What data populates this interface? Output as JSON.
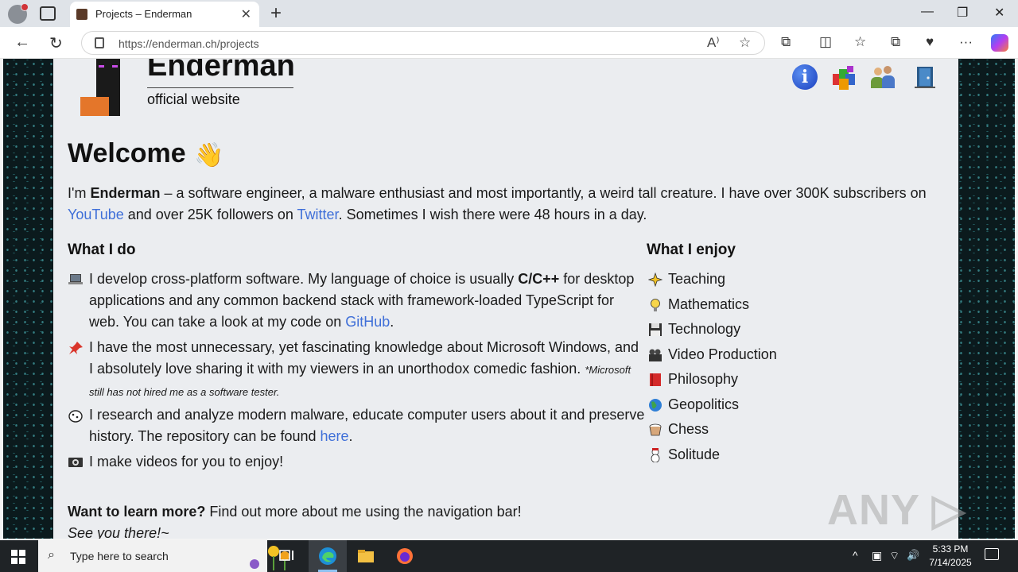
{
  "browser": {
    "tab_title": "Projects – Enderman",
    "new_tab": "+",
    "url": "https://enderman.ch/projects",
    "icons": {
      "back": "←",
      "refresh": "↻",
      "read_aloud": "A⁾",
      "favorite": "☆",
      "extensions": "⧉",
      "split": "◫",
      "favorites": "☆",
      "collections": "⧉",
      "performance": "♥",
      "more": "···",
      "minimize": "—",
      "restore": "❐",
      "close": "✕",
      "tab_close": "✕"
    }
  },
  "site": {
    "name": "Enderman",
    "subtitle": "official website",
    "info_icon_label": "i"
  },
  "welcome": {
    "title": "Welcome",
    "wave": "👋",
    "intro_1": "I'm ",
    "intro_name": "Enderman",
    "intro_2": " – a software engineer, a malware enthusiast and most importantly, a weird tall creature. I have over 300K subscribers on",
    "youtube": "YouTube",
    "intro_3": " and over 25K followers on ",
    "twitter": "Twitter",
    "intro_4": ". Sometimes I wish there were 48 hours in a day."
  },
  "what_i_do": {
    "heading": "What I do",
    "item1_a": "I develop cross-platform software. My language of choice is usually ",
    "item1_bold": "C/C++",
    "item1_b": " for desktop",
    "item1_line2": "applications and any common backend stack with framework-loaded TypeScript for",
    "item1_line3": "web. You can take a look at my code on ",
    "github": "GitHub",
    "dot": ".",
    "item2_line1": "I have the most unnecessary, yet fascinating knowledge about Microsoft Windows, and",
    "item2_line2": "I absolutely love sharing it with my viewers in an unorthodox comedic fashion. ",
    "item2_note_a": "*Microsoft",
    "item2_note_b": "still has not hired me as a software tester.",
    "item3_line1": "I research and analyze modern malware, educate computer users about it and preserve",
    "item3_line2": "history. The repository can be found ",
    "here": "here",
    "item4": "I make videos for you to enjoy!"
  },
  "what_i_enjoy": {
    "heading": "What I enjoy",
    "items": [
      "Teaching",
      "Mathematics",
      "Technology",
      "Video Production",
      "Philosophy",
      "Geopolitics",
      "Chess",
      "Solitude"
    ]
  },
  "footer": {
    "learn_bold": "Want to learn more?",
    "learn_rest": " Find out more about me using the navigation bar!",
    "see_you": "See you there!~"
  },
  "watermark": "ANY ▷ RUN",
  "taskbar": {
    "search_placeholder": "Type here to search",
    "time": "5:33 PM",
    "date": "7/14/2025",
    "tray": {
      "chevron": "^",
      "wifi": "⌔",
      "volume": "🔊"
    }
  }
}
